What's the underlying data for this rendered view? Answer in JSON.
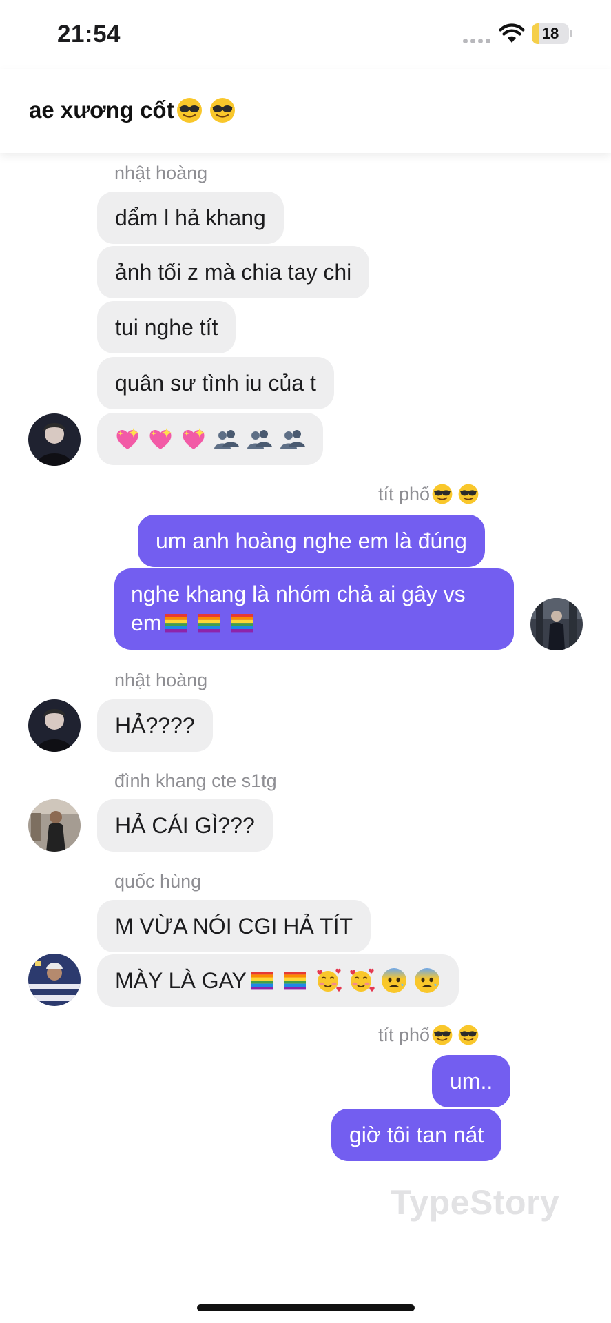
{
  "status_bar": {
    "time": "21:54",
    "battery_level": "18",
    "battery_fraction": 0.18
  },
  "header": {
    "title": "ae xương cốt",
    "title_emojis": [
      "sunglasses-emoji",
      "sunglasses-emoji"
    ]
  },
  "messages": {
    "g1": {
      "sender": "nhật hoàng",
      "texts": [
        "dẩm l hả khang",
        "ảnh tối z mà chia tay chi",
        "tui nghe tít",
        "quân sư tình iu của t"
      ],
      "emoji_message": [
        "sparkling-heart-emoji",
        "sparkling-heart-emoji",
        "sparkling-heart-emoji",
        "busts-in-silhouette-emoji",
        "busts-in-silhouette-emoji",
        "busts-in-silhouette-emoji"
      ]
    },
    "g2": {
      "sender": "tít phố",
      "sender_emojis": [
        "sunglasses-emoji",
        "sunglasses-emoji"
      ],
      "texts": [
        "um anh hoàng nghe em là đúng"
      ],
      "multi_line_1": "nghe khang là nhóm chả ai gây vs",
      "multi_line_2": "em",
      "multi_line_2_emojis": [
        "rainbow-flag-emoji",
        "rainbow-flag-emoji",
        "rainbow-flag-emoji"
      ]
    },
    "g3": {
      "sender": "nhật hoàng",
      "texts": [
        "HẢ????"
      ]
    },
    "g4": {
      "sender": "đình khang cte s1tg",
      "texts": [
        "HẢ CÁI GÌ???"
      ]
    },
    "g5": {
      "sender": "quốc hùng",
      "texts": [
        "M VỪA NÓI CGI HẢ TÍT",
        "MÀY LÀ GAY"
      ],
      "text_2_emojis": [
        "rainbow-flag-emoji",
        "rainbow-flag-emoji",
        "smiling-face-with-hearts-emoji",
        "smiling-face-with-hearts-emoji",
        "anxious-face-emoji",
        "anxious-face-emoji"
      ]
    },
    "g6": {
      "sender": "tít phố",
      "sender_emojis": [
        "sunglasses-emoji",
        "sunglasses-emoji"
      ],
      "texts": [
        "um..",
        "giờ tôi tan nát"
      ]
    }
  },
  "watermark": "TypeStory",
  "colors": {
    "outgoing_bubble": "#735ef0",
    "incoming_bubble": "#eeeeef",
    "name_label": "#8e8e93",
    "battery": "#f5cf4a"
  }
}
